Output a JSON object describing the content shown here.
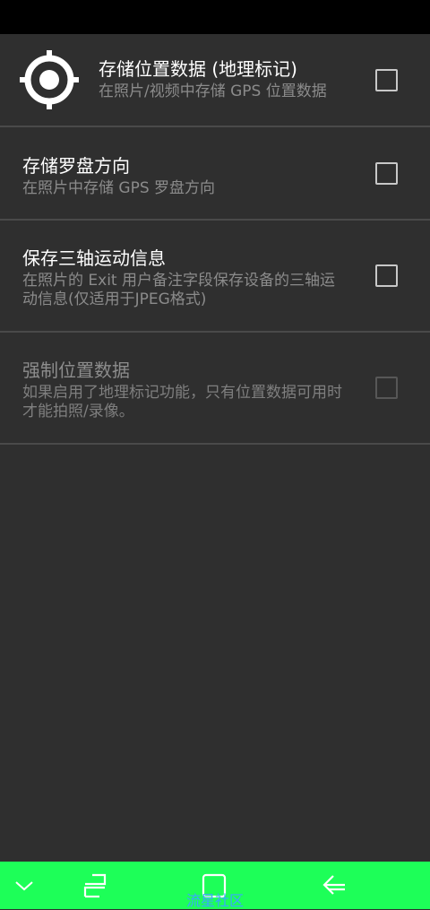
{
  "settings": [
    {
      "title": "存储位置数据 (地理标记)",
      "summary": "在照片/视频中存储 GPS 位置数据",
      "icon": "gps-target-icon",
      "enabled": true,
      "checked": false
    },
    {
      "title": "存储罗盘方向",
      "summary": "在照片中存储 GPS 罗盘方向",
      "enabled": true,
      "checked": false
    },
    {
      "title": "保存三轴运动信息",
      "summary": "在照片的 Exit 用户备注字段保存设备的三轴运动信息(仅适用于JPEG格式)",
      "enabled": true,
      "checked": false
    },
    {
      "title": "强制位置数据",
      "summary": "如果启用了地理标记功能，只有位置数据可用时才能拍照/录像。",
      "enabled": false,
      "checked": false
    }
  ],
  "nav_bar": {
    "color": "#1dff58",
    "watermark": "流星社区",
    "icons": [
      "chevron-down-icon",
      "recents-icon",
      "home-icon",
      "back-icon"
    ]
  }
}
